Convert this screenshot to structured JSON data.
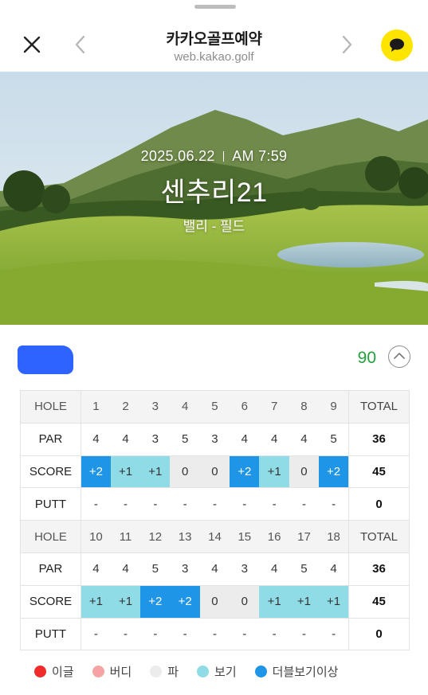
{
  "header": {
    "title": "카카오골프예약",
    "url": "web.kakao.golf"
  },
  "hero": {
    "date": "2025.06.22",
    "time": "AM 7:59",
    "course": "센추리21",
    "sub_course": "밸리 - 필드"
  },
  "summary": {
    "total_score": "90"
  },
  "front_nine": {
    "hole_label": "HOLE",
    "par_label": "PAR",
    "score_label": "SCORE",
    "putt_label": "PUTT",
    "total_label": "TOTAL",
    "holes": [
      "1",
      "2",
      "3",
      "4",
      "5",
      "6",
      "7",
      "8",
      "9"
    ],
    "par": [
      "4",
      "4",
      "3",
      "5",
      "3",
      "4",
      "4",
      "4",
      "5"
    ],
    "score": [
      "+2",
      "+1",
      "+1",
      "0",
      "0",
      "+2",
      "+1",
      "0",
      "+2"
    ],
    "putt": [
      "-",
      "-",
      "-",
      "-",
      "-",
      "-",
      "-",
      "-",
      "-"
    ],
    "par_total": "36",
    "score_total": "45",
    "putt_total": "0"
  },
  "back_nine": {
    "hole_label": "HOLE",
    "par_label": "PAR",
    "score_label": "SCORE",
    "putt_label": "PUTT",
    "total_label": "TOTAL",
    "holes": [
      "10",
      "11",
      "12",
      "13",
      "14",
      "15",
      "16",
      "17",
      "18"
    ],
    "par": [
      "4",
      "4",
      "5",
      "3",
      "4",
      "3",
      "4",
      "5",
      "4"
    ],
    "score": [
      "+1",
      "+1",
      "+2",
      "+2",
      "0",
      "0",
      "+1",
      "+1",
      "+1"
    ],
    "putt": [
      "-",
      "-",
      "-",
      "-",
      "-",
      "-",
      "-",
      "-",
      "-"
    ],
    "par_total": "36",
    "score_total": "45",
    "putt_total": "0"
  },
  "legend": [
    {
      "label": "이글",
      "color": "#ef2b2b"
    },
    {
      "label": "버디",
      "color": "#f5a3a3"
    },
    {
      "label": "파",
      "color": "#ececec"
    },
    {
      "label": "보기",
      "color": "#8fdbe6"
    },
    {
      "label": "더블보기이상",
      "color": "#1f95e8"
    }
  ],
  "score_colors": {
    "double_bogey_plus": "#1f95e8",
    "bogey": "#8fdbe6",
    "par": "#ececec"
  }
}
